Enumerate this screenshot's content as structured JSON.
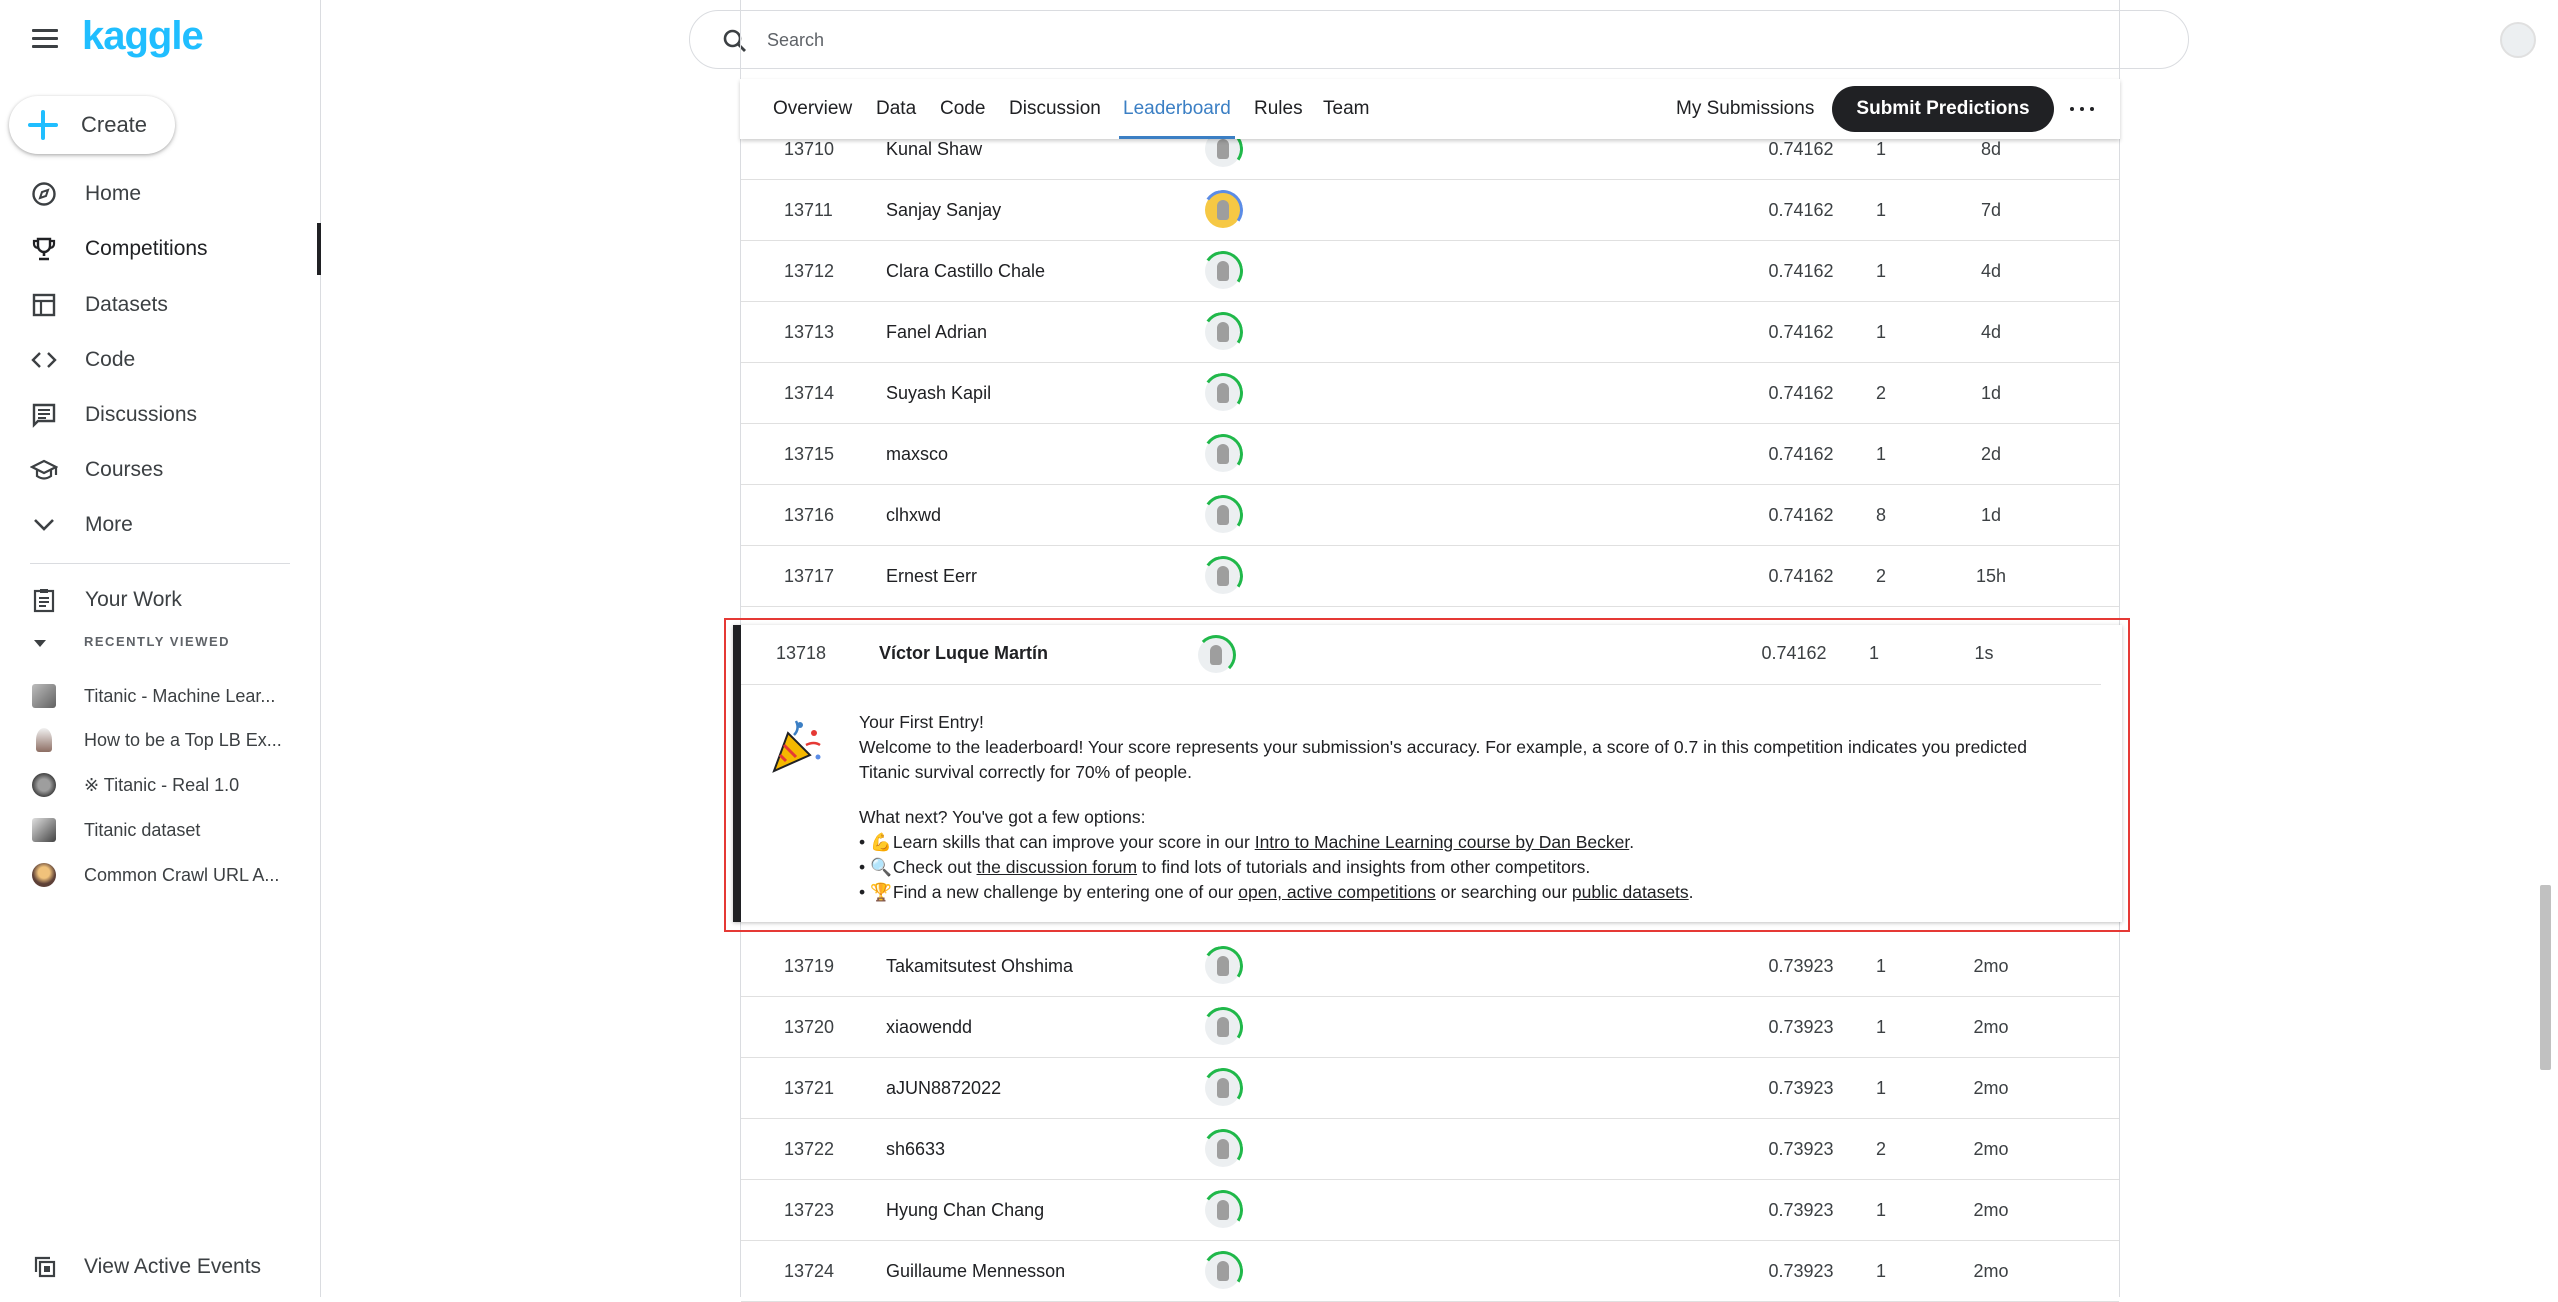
{
  "app": {
    "logo": "kaggle"
  },
  "sidebar": {
    "create_label": "Create",
    "nav": [
      {
        "label": "Home",
        "icon": "compass-icon"
      },
      {
        "label": "Competitions",
        "icon": "trophy-icon",
        "active": true
      },
      {
        "label": "Datasets",
        "icon": "table-icon"
      },
      {
        "label": "Code",
        "icon": "code-icon"
      },
      {
        "label": "Discussions",
        "icon": "comment-icon"
      },
      {
        "label": "Courses",
        "icon": "school-icon"
      },
      {
        "label": "More",
        "icon": "chevron-down-icon"
      }
    ],
    "your_work": "Your Work",
    "recently_viewed_heading": "RECENTLY VIEWED",
    "recent": [
      "Titanic - Machine Lear...",
      "How to be a Top LB Ex...",
      "※ Titanic - Real 1.0",
      "Titanic dataset",
      "Common Crawl URL A..."
    ],
    "view_events": "View Active Events"
  },
  "search": {
    "placeholder": "Search",
    "value": ""
  },
  "tabs": {
    "items": [
      "Overview",
      "Data",
      "Code",
      "Discussion",
      "Leaderboard",
      "Rules",
      "Team"
    ],
    "active": "Leaderboard",
    "my_submissions": "My Submissions",
    "submit_button": "Submit Predictions"
  },
  "leaderboard": {
    "rows_above": [
      {
        "rank": "13710",
        "name": "Kunal Shaw",
        "score": "0.74162",
        "entries": "1",
        "last": "8d"
      },
      {
        "rank": "13711",
        "name": "Sanjay Sanjay",
        "score": "0.74162",
        "entries": "1",
        "last": "7d"
      },
      {
        "rank": "13712",
        "name": "Clara Castillo Chale",
        "score": "0.74162",
        "entries": "1",
        "last": "4d"
      },
      {
        "rank": "13713",
        "name": "Fanel Adrian",
        "score": "0.74162",
        "entries": "1",
        "last": "4d"
      },
      {
        "rank": "13714",
        "name": "Suyash Kapil",
        "score": "0.74162",
        "entries": "2",
        "last": "1d"
      },
      {
        "rank": "13715",
        "name": "maxsco",
        "score": "0.74162",
        "entries": "1",
        "last": "2d"
      },
      {
        "rank": "13716",
        "name": "clhxwd",
        "score": "0.74162",
        "entries": "8",
        "last": "1d"
      },
      {
        "rank": "13717",
        "name": "Ernest Eerr",
        "score": "0.74162",
        "entries": "2",
        "last": "15h"
      }
    ],
    "my_entry": {
      "rank": "13718",
      "name": "Víctor Luque Martín",
      "score": "0.74162",
      "entries": "1",
      "last": "1s"
    },
    "rows_below": [
      {
        "rank": "13719",
        "name": "Takamitsutest Ohshima",
        "score": "0.73923",
        "entries": "1",
        "last": "2mo"
      },
      {
        "rank": "13720",
        "name": "xiaowendd",
        "score": "0.73923",
        "entries": "1",
        "last": "2mo"
      },
      {
        "rank": "13721",
        "name": "aJUN8872022",
        "score": "0.73923",
        "entries": "1",
        "last": "2mo"
      },
      {
        "rank": "13722",
        "name": "sh6633",
        "score": "0.73923",
        "entries": "2",
        "last": "2mo"
      },
      {
        "rank": "13723",
        "name": "Hyung Chan Chang",
        "score": "0.73923",
        "entries": "1",
        "last": "2mo"
      },
      {
        "rank": "13724",
        "name": "Guillaume Mennesson",
        "score": "0.73923",
        "entries": "1",
        "last": "2mo"
      }
    ]
  },
  "first_entry": {
    "title": "Your First Entry!",
    "message": "Welcome to the leaderboard! Your score represents your submission's accuracy. For example, a score of 0.7 in this competition indicates you predicted Titanic survival correctly for 70% of people.",
    "next_heading": "What next? You've got a few options:",
    "line1_pre": "Learn skills that can improve your score in our ",
    "line1_link": "Intro to Machine Learning course by Dan Becker",
    "line1_post": ".",
    "line2_pre": "Check out ",
    "line2_link": "the discussion forum",
    "line2_post": " to find lots of tutorials and insights from other competitors.",
    "line3_pre": "Find a new challenge by entering one of our ",
    "line3_link1": "open, active competitions",
    "line3_mid": " or searching our ",
    "line3_link2": "public datasets",
    "line3_post": ".",
    "emoji1": "💪",
    "emoji2": "🔍",
    "emoji3": "🏆"
  },
  "colors": {
    "brand": "#20beff",
    "accent": "#3b7fc4",
    "highlight": "#e53935",
    "dark": "#202124"
  }
}
